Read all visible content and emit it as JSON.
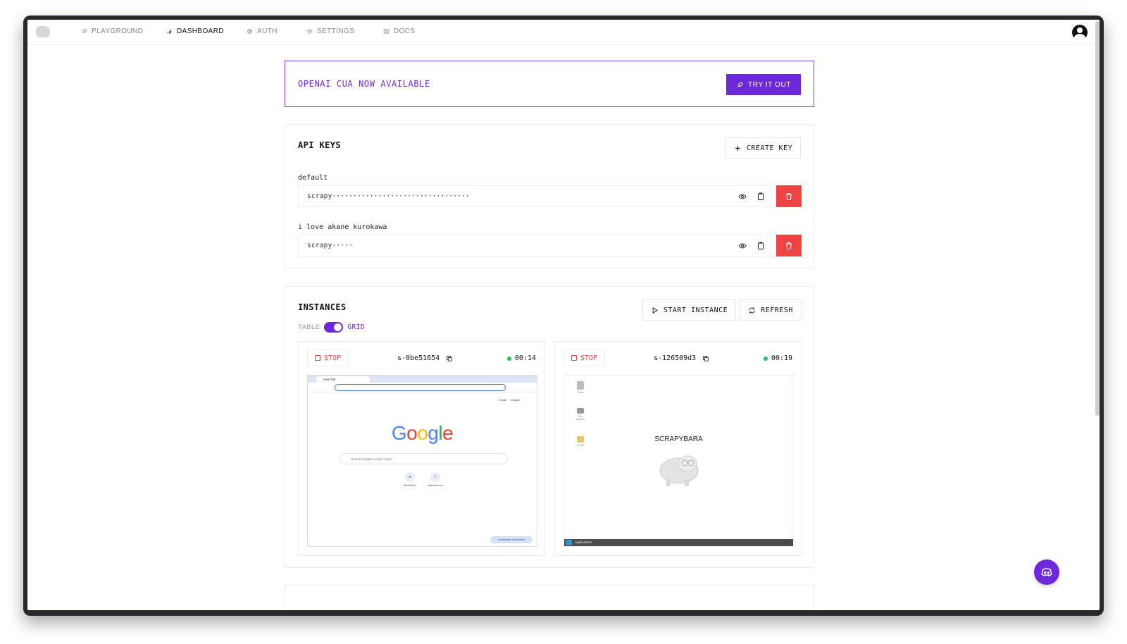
{
  "nav": {
    "items": [
      {
        "label": "PLAYGROUND",
        "icon": "rocket-icon",
        "active": false
      },
      {
        "label": "DASHBOARD",
        "icon": "bar-chart-icon",
        "active": true
      },
      {
        "label": "AUTH",
        "icon": "fingerprint-icon",
        "active": false
      },
      {
        "label": "SETTINGS",
        "icon": "gear-icon",
        "active": false
      },
      {
        "label": "DOCS",
        "icon": "book-icon",
        "active": false
      }
    ]
  },
  "banner": {
    "title": "OPENAI CUA NOW AVAILABLE",
    "button_label": "TRY IT OUT"
  },
  "api_keys": {
    "title": "API KEYS",
    "create_label": "CREATE KEY",
    "keys": [
      {
        "name": "default",
        "value": "scrapy-································"
      },
      {
        "name": "i love akane kurokawa",
        "value": "scrapy-····"
      }
    ]
  },
  "instances": {
    "title": "INSTANCES",
    "start_label": "START INSTANCE",
    "refresh_label": "REFRESH",
    "view_toggle": {
      "off_label": "TABLE",
      "on_label": "GRID",
      "selected": "GRID"
    },
    "items": [
      {
        "stop_label": "STOP",
        "id": "s-0be51654",
        "uptime": "00:14",
        "status_color": "#22c55e",
        "preview": {
          "type": "browser",
          "tab_title": "New Tab",
          "links": [
            "Gmail",
            "Images"
          ],
          "logo": [
            "G",
            "o",
            "o",
            "g",
            "l",
            "e"
          ],
          "search_placeholder": "Search Google or type a URL",
          "shortcuts": [
            "Web Store",
            "Add shortcut"
          ],
          "customize_label": "Customize Chromium"
        }
      },
      {
        "stop_label": "STOP",
        "id": "s-126509d3",
        "uptime": "00:19",
        "status_color": "#22c55e",
        "preview": {
          "type": "desktop",
          "icons": [
            "Trash",
            "File System",
            "Home"
          ],
          "title": "SCRAPYBARA",
          "taskbar_label": "Applications"
        }
      }
    ]
  },
  "colors": {
    "accent": "#6d28d9",
    "danger": "#ef4444",
    "online": "#22c55e"
  }
}
